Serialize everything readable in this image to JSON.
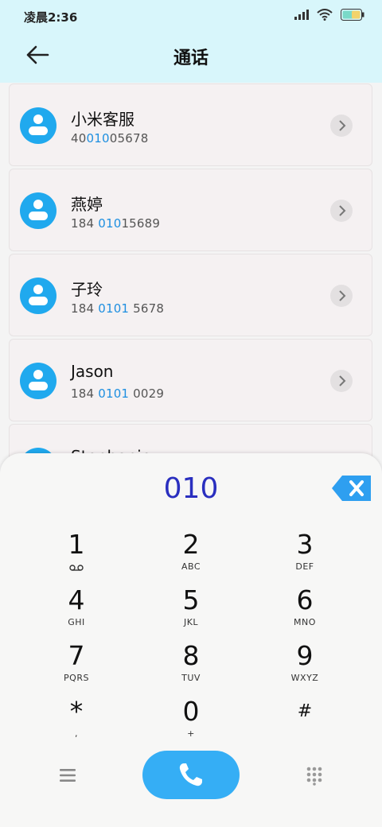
{
  "status_bar": {
    "time": "凌晨2:36"
  },
  "header": {
    "title": "通话"
  },
  "contacts": [
    {
      "name": "小米客服",
      "number_pre": "40",
      "number_hl": "010",
      "number_post": "05678"
    },
    {
      "name": "燕婷",
      "number_pre": "184 ",
      "number_hl": "010",
      "number_post": "15689"
    },
    {
      "name": "子玲",
      "number_pre": "184 ",
      "number_hl": "0101",
      "number_post": " 5678"
    },
    {
      "name": "Jason",
      "number_pre": "184 ",
      "number_hl": "0101",
      "number_post": " 0029"
    },
    {
      "name": "Stephanie",
      "number_pre": "",
      "number_hl": "",
      "number_post": ""
    }
  ],
  "dialer": {
    "input": "010",
    "keys": [
      {
        "digit": "1",
        "letters": ""
      },
      {
        "digit": "2",
        "letters": "ABC"
      },
      {
        "digit": "3",
        "letters": "DEF"
      },
      {
        "digit": "4",
        "letters": "GHI"
      },
      {
        "digit": "5",
        "letters": "JKL"
      },
      {
        "digit": "6",
        "letters": "MNO"
      },
      {
        "digit": "7",
        "letters": "PQRS"
      },
      {
        "digit": "8",
        "letters": "TUV"
      },
      {
        "digit": "9",
        "letters": "WXYZ"
      },
      {
        "digit": "*",
        "letters": ","
      },
      {
        "digit": "0",
        "letters": "+"
      },
      {
        "digit": "#",
        "letters": ""
      }
    ]
  },
  "icons": {
    "back": "arrow-left-icon",
    "delete": "backspace-icon",
    "call": "phone-icon",
    "menu": "menu-icon",
    "dialpad": "dialpad-icon",
    "voicemail": "voicemail-icon"
  },
  "colors": {
    "accent": "#20a9ee",
    "call": "#35aef5",
    "digits": "#2a2fbf",
    "highlight": "#1e8fe0",
    "header_bg": "#d8f6fb"
  }
}
